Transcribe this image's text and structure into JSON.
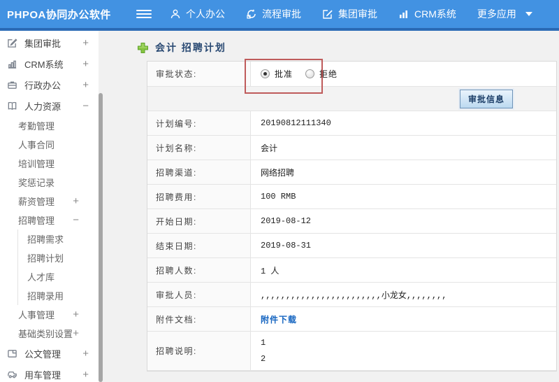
{
  "header": {
    "logo": "PHPOA协同办公软件",
    "nav": [
      {
        "label": "个人办公"
      },
      {
        "label": "流程审批"
      },
      {
        "label": "集团审批"
      },
      {
        "label": "CRM系统"
      },
      {
        "label": "更多应用"
      }
    ]
  },
  "sidebar": {
    "items": [
      {
        "label": "集团审批",
        "toggle": "+"
      },
      {
        "label": "CRM系统",
        "toggle": "+"
      },
      {
        "label": "行政办公",
        "toggle": "+"
      },
      {
        "label": "人力资源",
        "toggle": "−"
      },
      {
        "label": "考勤管理",
        "toggle": ""
      },
      {
        "label": "人事合同",
        "toggle": ""
      },
      {
        "label": "培训管理",
        "toggle": ""
      },
      {
        "label": "奖惩记录",
        "toggle": ""
      },
      {
        "label": "薪资管理",
        "toggle": "+"
      },
      {
        "label": "招聘管理",
        "toggle": "−"
      },
      {
        "label": "招聘需求",
        "toggle": ""
      },
      {
        "label": "招聘计划",
        "toggle": ""
      },
      {
        "label": "人才库",
        "toggle": ""
      },
      {
        "label": "招聘录用",
        "toggle": ""
      },
      {
        "label": "人事管理",
        "toggle": "+"
      },
      {
        "label": "基础类别设置",
        "toggle": "+"
      },
      {
        "label": "公文管理",
        "toggle": "+"
      },
      {
        "label": "用车管理",
        "toggle": "+"
      }
    ]
  },
  "main": {
    "title": "会计 招聘计划",
    "approval_row": {
      "label": "审批状态:",
      "options": [
        {
          "label": "批准",
          "selected": true
        },
        {
          "label": "拒绝",
          "selected": false
        }
      ]
    },
    "approval_info_button": "审批信息",
    "rows": [
      {
        "label": "计划编号:",
        "value": "20190812111340"
      },
      {
        "label": "计划名称:",
        "value": "会计"
      },
      {
        "label": "招聘渠道:",
        "value": "网络招聘"
      },
      {
        "label": "招聘费用:",
        "value": "100 RMB"
      },
      {
        "label": "开始日期:",
        "value": "2019-08-12"
      },
      {
        "label": "结束日期:",
        "value": "2019-08-31"
      },
      {
        "label": "招聘人数:",
        "value": "1 人"
      },
      {
        "label": "审批人员:",
        "value": ",,,,,,,,,,,,,,,,,,,,,,,,小龙女,,,,,,,,"
      },
      {
        "label": "附件文档:",
        "value": "附件下载"
      },
      {
        "label": "招聘说明:",
        "lines": [
          "1",
          "2"
        ]
      }
    ]
  },
  "colors": {
    "header_blue": "#4292e2",
    "header_blue_dark": "#2a6ab5",
    "annotation_red": "#bf5b5b",
    "link_blue": "#1464c0",
    "plus_green": "#7fbf3f"
  }
}
